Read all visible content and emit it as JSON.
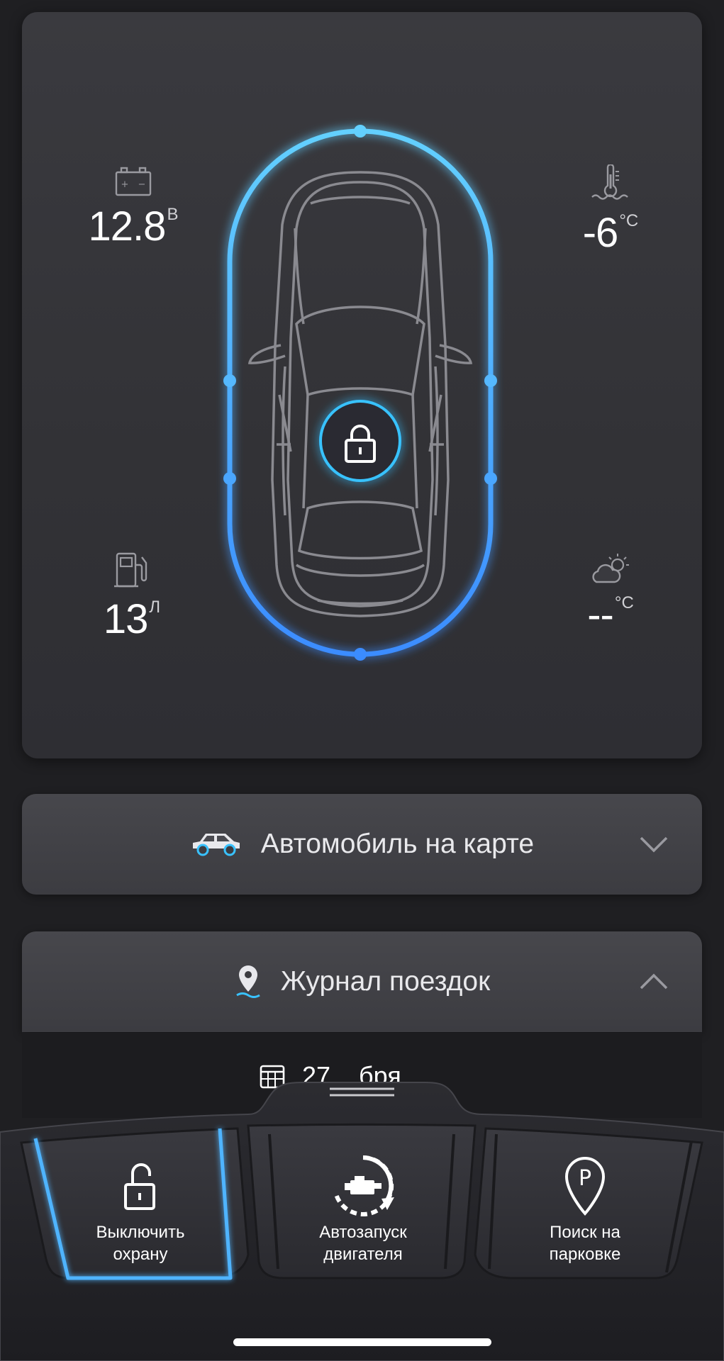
{
  "status": {
    "battery": {
      "value": "12.8",
      "unit": "В"
    },
    "engine_temp": {
      "value": "-6",
      "unit": "°C"
    },
    "fuel": {
      "value": "13",
      "unit": "Л"
    },
    "outside_temp": {
      "value": "--",
      "unit": "°C"
    },
    "car_state": "locked"
  },
  "sections": {
    "map": {
      "label": "Автомобиль на карте",
      "icon": "car-icon",
      "chevron": "chevron-down-icon"
    },
    "trips": {
      "label": "Журнал поездок",
      "icon": "location-pin-icon",
      "chevron": "chevron-up-icon",
      "date_text": "27 ...бря"
    }
  },
  "actions": [
    {
      "label_line1": "Выключить",
      "label_line2": "охрану",
      "icon": "unlock-icon",
      "active": true
    },
    {
      "label_line1": "Автозапуск",
      "label_line2": "двигателя",
      "icon": "engine-start-icon",
      "active": false
    },
    {
      "label_line1": "Поиск на",
      "label_line2": "парковке",
      "icon": "parking-pin-icon",
      "active": false
    }
  ],
  "colors": {
    "accent": "#49b6ff",
    "accent_glow": "#2fa0ff",
    "card": "#38383d",
    "background": "#1f1f22"
  }
}
